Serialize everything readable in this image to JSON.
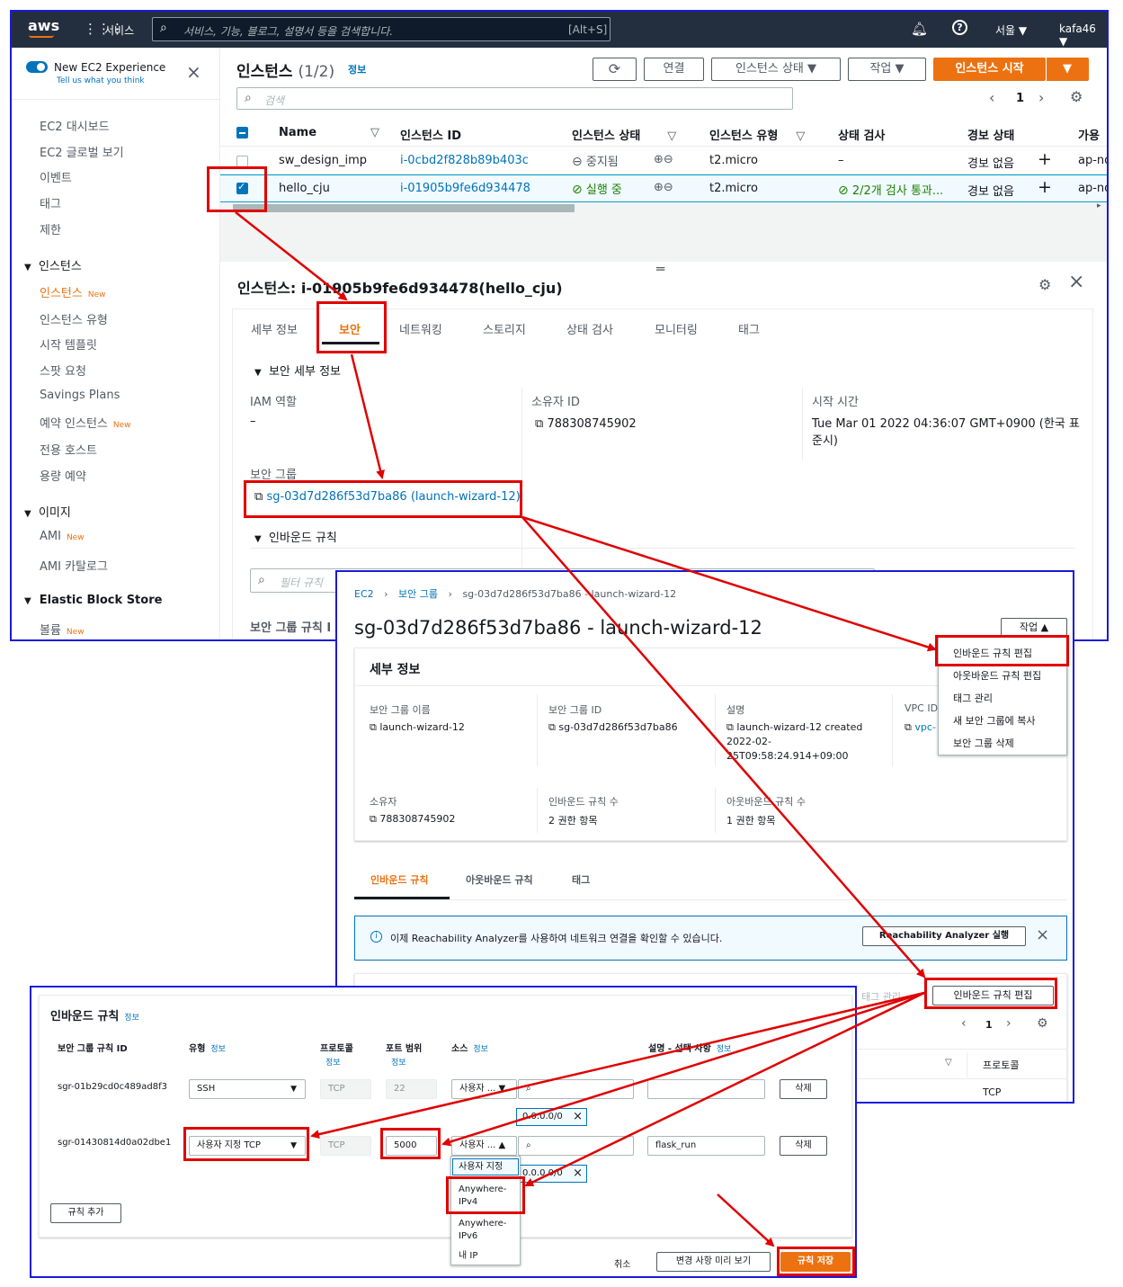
{
  "topbar": {
    "logo": "aws",
    "services": "서비스",
    "search_placeholder": "서비스, 기능, 블로그, 설명서 등을 검색합니다.",
    "search_shortcut": "[Alt+S]",
    "region": "서울 ▼",
    "user": "kafa46 ▼"
  },
  "sidebar": {
    "new_exp": "New EC2 Experience",
    "tell_us": "Tell us what you think",
    "items_top": [
      "EC2 대시보드",
      "EC2 글로벌 보기",
      "이벤트",
      "태그",
      "제한"
    ],
    "sec_instances": "인스턴스",
    "instances_items": [
      "인스턴스",
      "인스턴스 유형",
      "시작 템플릿",
      "스팟 요청",
      "Savings Plans",
      "예약 인스턴스",
      "전용 호스트",
      "용량 예약"
    ],
    "sec_images": "이미지",
    "images_items": [
      "AMI",
      "AMI 카탈로그"
    ],
    "sec_ebs": "Elastic Block Store",
    "ebs_items": [
      "볼륨"
    ],
    "new_label": "New"
  },
  "instances": {
    "title": "인스턴스",
    "count": "(1/2)",
    "info": "정보",
    "buttons": {
      "connect": "연결",
      "state": "인스턴스 상태 ▼",
      "actions": "작업 ▼",
      "launch": "인스턴스 시작"
    },
    "search_placeholder": "검색",
    "page": "1",
    "columns": [
      "Name",
      "인스턴스 ID",
      "인스턴스 상태",
      "인스턴스 유형",
      "상태 검사",
      "경보 상태",
      "가용"
    ],
    "rows": [
      {
        "name": "sw_design_imp",
        "id": "i-0cbd2f828b89b403c",
        "state": "중지됨",
        "type": "t2.micro",
        "check": "–",
        "alarm": "경보 없음",
        "az": "ap-no"
      },
      {
        "name": "hello_cju",
        "id": "i-01905b9fe6d934478",
        "state": "실행 중",
        "type": "t2.micro",
        "check": "2/2개 검사 통과...",
        "alarm": "경보 없음",
        "az": "ap-no"
      }
    ]
  },
  "details": {
    "title": "인스턴스: i-01905b9fe6d934478(hello_cju)",
    "tabs": [
      "세부 정보",
      "보안",
      "네트워킹",
      "스토리지",
      "상태 검사",
      "모니터링",
      "태그"
    ],
    "security_details": "보안 세부 정보",
    "iam_label": "IAM 역할",
    "iam_value": "–",
    "owner_label": "소유자 ID",
    "owner_value": "788308745902",
    "launch_label": "시작 시간",
    "launch_value1": "Tue Mar 01 2022 04:36:07 GMT+0900 (한국 표",
    "launch_value2": "준시)",
    "sg_label": "보안 그룹",
    "sg_value": "sg-03d7d286f53d7ba86 (launch-wizard-12)",
    "inbound_rules": "인바운드 규칙",
    "filter_placeholder": "필터 규칙",
    "sg_rule": "보안 그룹 규칙 I"
  },
  "sgpage": {
    "breadcrumb": [
      "EC2",
      "보안 그룹",
      "sg-03d7d286f53d7ba86 - launch-wizard-12"
    ],
    "title": "sg-03d7d286f53d7ba86 - launch-wizard-12",
    "actions": "작업 ▲",
    "menu": [
      "인바운드 규칙 편집",
      "아웃바운드 규칙 편집",
      "태그 관리",
      "새 보안 그룹에 복사",
      "보안 그룹 삭제"
    ],
    "detail_title": "세부 정보",
    "f_name_l": "보안 그룹 이름",
    "f_name_v": "launch-wizard-12",
    "f_id_l": "보안 그룹 ID",
    "f_id_v": "sg-03d7d286f53d7ba86",
    "f_desc_l": "설명",
    "f_desc_v1": "launch-wizard-12 created",
    "f_desc_v2": "2022-02-",
    "f_desc_v3": "25T09:58:24.914+09:00",
    "f_vpc_l": "VPC ID",
    "f_vpc_v": "vpc-",
    "f_owner_l": "소유자",
    "f_owner_v": "788308745902",
    "f_in_l": "인바운드 규칙 수",
    "f_in_v": "2 권한 항목",
    "f_out_l": "아웃바운드 규칙 수",
    "f_out_v": "1 권한 항목",
    "tabs": [
      "인바운드 규칙",
      "아웃바운드 규칙",
      "태그"
    ],
    "banner": "이제 Reachability Analyzer를 사용하여 네트워크 연결을 확인할 수 있습니다.",
    "banner_btn": "Reachability Analyzer 실행",
    "tag_manage": "태그 관리",
    "edit_inbound": "인바운드 규칙 편집",
    "page": "1",
    "protocol": "프로토콜",
    "tcp": "TCP"
  },
  "editrules": {
    "title": "인바운드 규칙",
    "info": "정보",
    "headers": {
      "id": "보안 그룹 규칙 ID",
      "type": "유형",
      "protocol": "프로토콜",
      "port": "포트 범위",
      "source": "소스",
      "desc": "설명 - 선택 사항"
    },
    "rows": [
      {
        "id": "sgr-01b29cd0c489ad8f3",
        "type": "SSH",
        "protocol": "TCP",
        "port": "22",
        "source": "사용자 ... ▼",
        "cidr": "0.0.0.0/0",
        "desc": "",
        "delete": "삭제"
      },
      {
        "id": "sgr-01430814d0a02dbe1",
        "type": "사용자 지정 TCP",
        "protocol": "TCP",
        "port": "5000",
        "source": "사용자 ... ▲",
        "cidr": "0.0.0.0/0",
        "desc": "flask_run",
        "delete": "삭제"
      }
    ],
    "dropdown": [
      "사용자 지정",
      "Anywhere-IPv4",
      "Anywhere-IPv6",
      "내 IP"
    ],
    "add_rule": "규칙 추가",
    "cancel": "취소",
    "preview": "변경 사항 미리 보기",
    "save": "규칙 저장"
  },
  "colors": {
    "accent": "#ec7211",
    "link": "#0073bb",
    "highlight": "#e00000",
    "frame": "#1a1adb"
  }
}
